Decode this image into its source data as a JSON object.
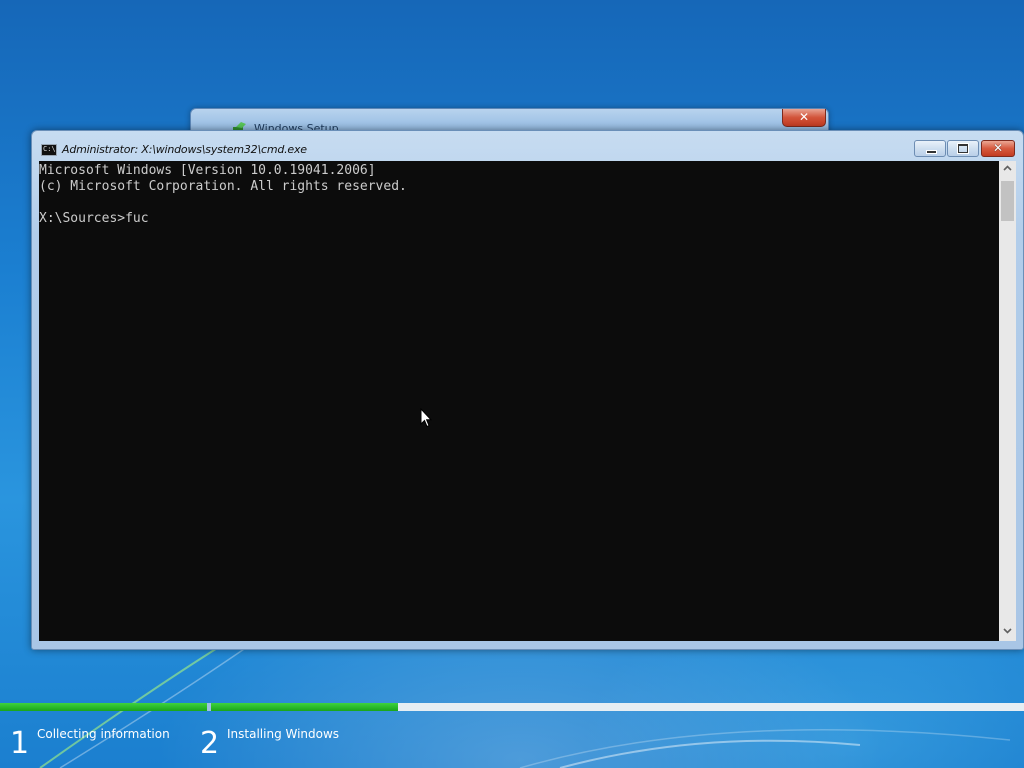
{
  "colors": {
    "desktop_blue": "#1b7fd1",
    "console_background": "#0c0c0c",
    "console_text": "#cccccc",
    "progress_green": "#1aa51a"
  },
  "setup_window": {
    "title": "Windows Setup",
    "icon": "windows-setup-icon",
    "close_icon": "close-icon"
  },
  "cmd_window": {
    "title": "Administrator: X:\\windows\\system32\\cmd.exe",
    "icon": "cmd-icon",
    "icon_text": "C:\\",
    "console_lines": [
      "Microsoft Windows [Version 10.0.19041.2006]",
      "(c) Microsoft Corporation. All rights reserved.",
      "",
      "X:\\Sources>fuc"
    ],
    "scroll_up_icon": "chevron-up-icon",
    "scroll_down_icon": "chevron-down-icon"
  },
  "setup_progress": {
    "steps": [
      {
        "number": "1",
        "label": "Collecting information",
        "progress": 1.0
      },
      {
        "number": "2",
        "label": "Installing Windows",
        "progress": 0.23
      }
    ]
  }
}
